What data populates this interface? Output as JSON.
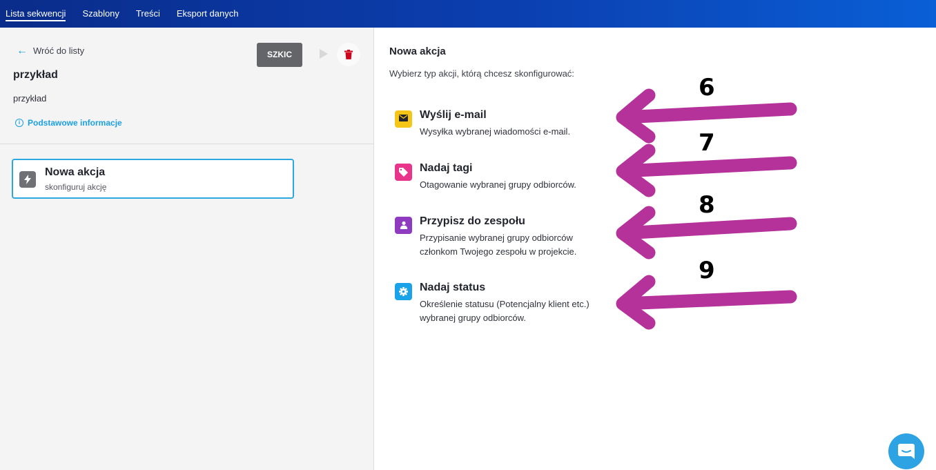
{
  "nav": {
    "tabs": [
      {
        "label": "Lista sekwencji",
        "active": true
      },
      {
        "label": "Szablony",
        "active": false
      },
      {
        "label": "Treści",
        "active": false
      },
      {
        "label": "Eksport danych",
        "active": false
      }
    ]
  },
  "left": {
    "back_label": "Wróć do listy",
    "sequence_title": "przykład",
    "sequence_description": "przykład",
    "info_link": "Podstawowe informacje",
    "status_label": "SZKIC",
    "action_card": {
      "title": "Nowa akcja",
      "subtitle": "skonfiguruj akcję"
    }
  },
  "right": {
    "title": "Nowa akcja",
    "subtitle": "Wybierz typ akcji, którą chcesz skonfigurować:",
    "options": [
      {
        "title": "Wyślij e-mail",
        "desc_line1": "Wysyłka wybranej wiadomości e-mail.",
        "desc_line2": "",
        "icon": "envelope-icon",
        "color": "#f5c518"
      },
      {
        "title": "Nadaj tagi",
        "desc_line1": "Otagowanie wybranej grupy odbiorców.",
        "desc_line2": "",
        "icon": "tag-icon",
        "color": "#e8348a"
      },
      {
        "title": "Przypisz do zespołu",
        "desc_line1": "Przypisanie wybranej grupy odbiorców",
        "desc_line2": "członkom Twojego zespołu w projekcie.",
        "icon": "person-icon",
        "color": "#8e3bbf"
      },
      {
        "title": "Nadaj status",
        "desc_line1": "Określenie statusu (Potencjalny klient etc.)",
        "desc_line2": "wybranej grupy odbiorców.",
        "icon": "gear-icon",
        "color": "#1aa3e8"
      }
    ]
  },
  "annotations": {
    "numbers": [
      "6",
      "7",
      "8",
      "9"
    ],
    "arrow_color": "#b5329a"
  },
  "colors": {
    "accent": "#1a9fe0",
    "nav_start": "#0a2c8a",
    "nav_end": "#0a5fd6",
    "delete": "#d0021b"
  }
}
